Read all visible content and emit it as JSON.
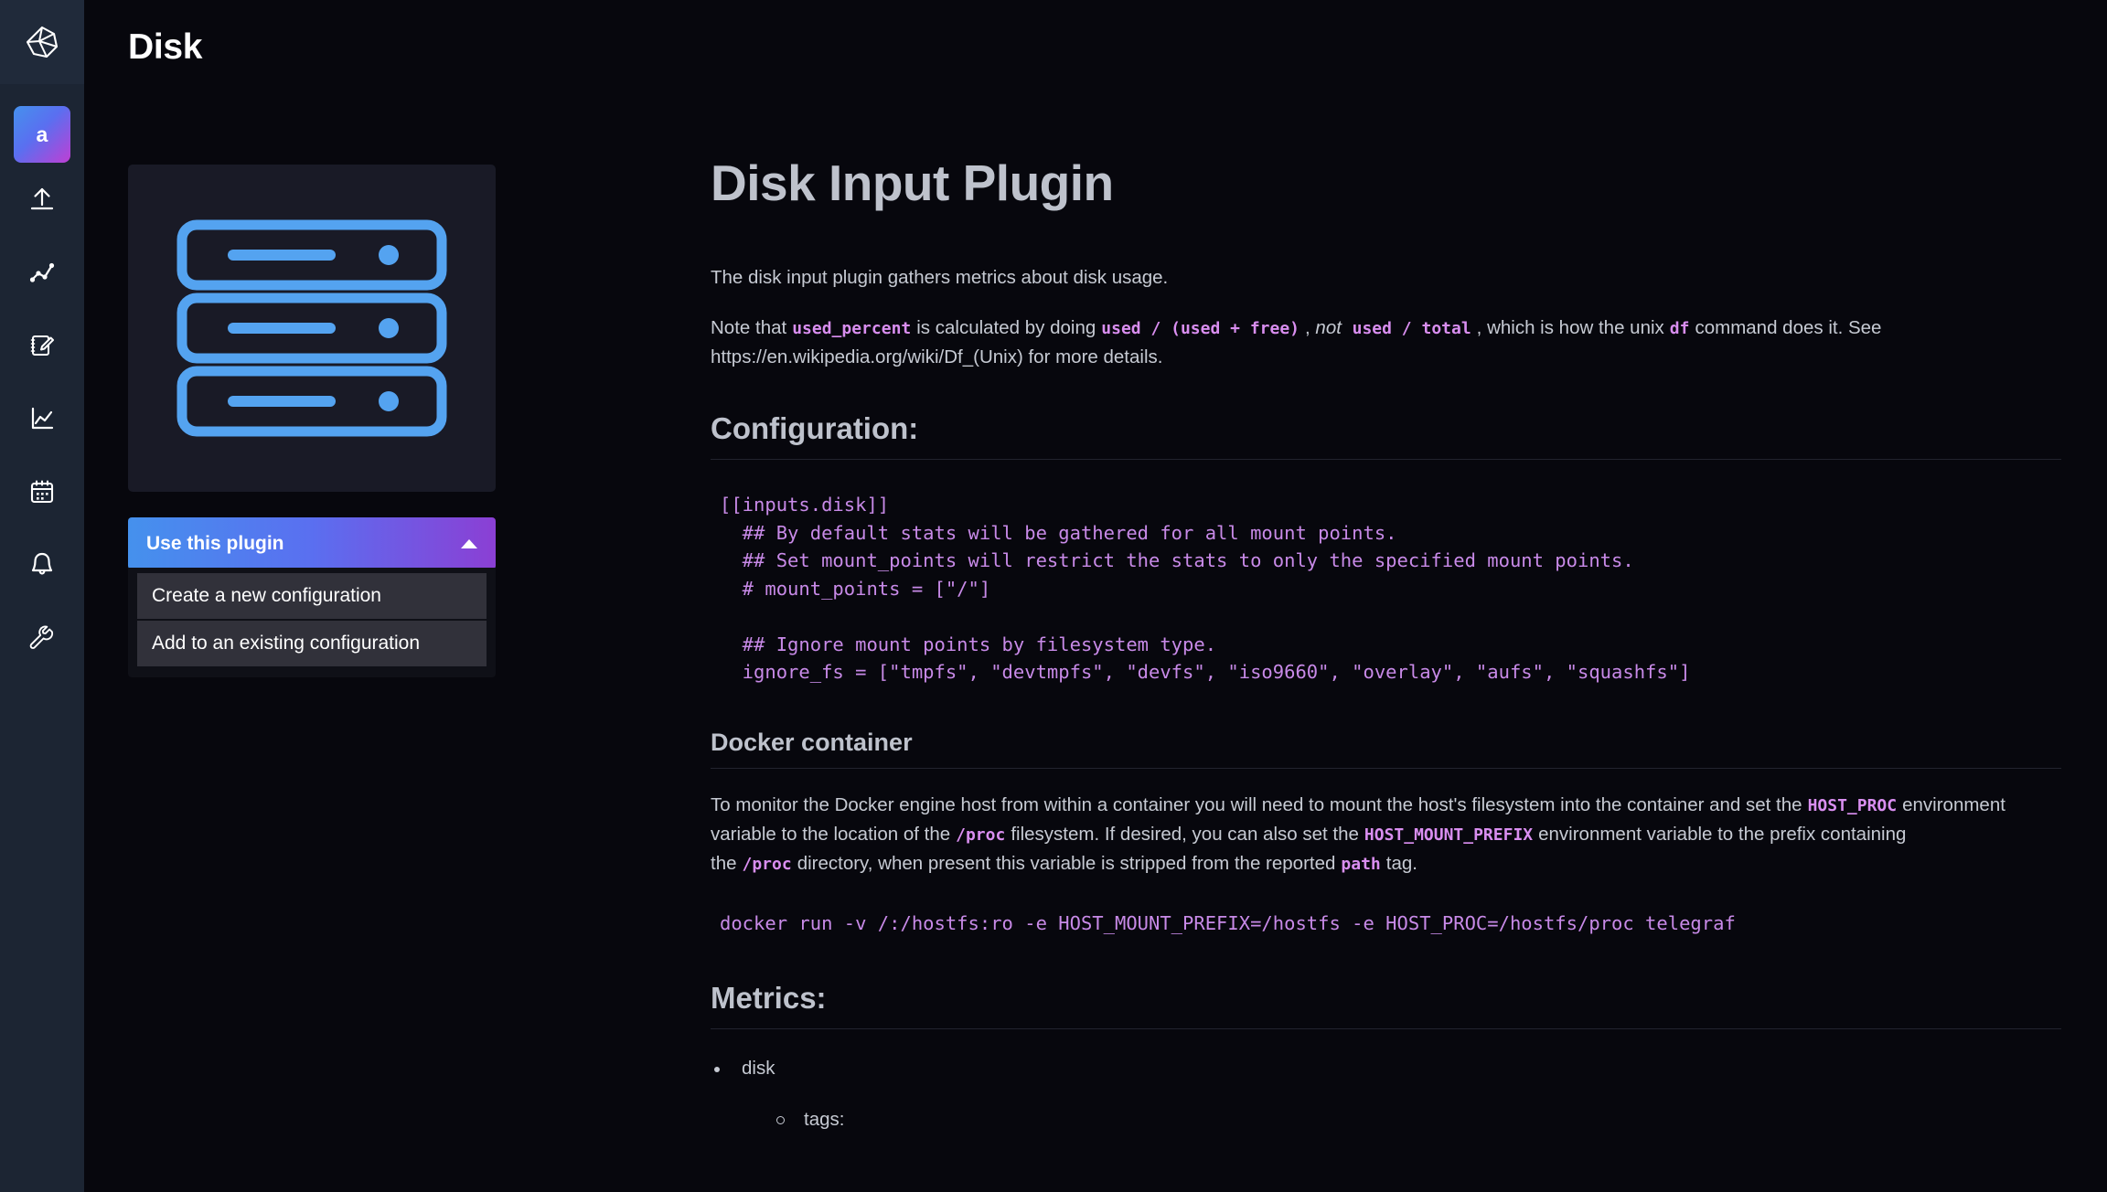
{
  "nav": {
    "logo_name": "influxdb-logo",
    "avatar_label": "a",
    "items": [
      {
        "name": "load-data",
        "icon": "upload-icon"
      },
      {
        "name": "data-explorer",
        "icon": "data-explorer-icon"
      },
      {
        "name": "notebooks",
        "icon": "notebook-edit-icon"
      },
      {
        "name": "dashboards",
        "icon": "dashboard-graph-icon"
      },
      {
        "name": "tasks",
        "icon": "calendar-icon"
      },
      {
        "name": "alerts",
        "icon": "bell-icon"
      },
      {
        "name": "settings",
        "icon": "wrench-icon"
      }
    ]
  },
  "header": {
    "title": "Disk"
  },
  "left_panel": {
    "card_icon": "disk-stack-icon",
    "use_plugin_label": "Use this plugin",
    "chevron_icon": "chevron-up-icon",
    "menu_items": [
      "Create a new configuration",
      "Add to an existing configuration"
    ]
  },
  "doc": {
    "title": "Disk Input Plugin",
    "intro": "The disk input plugin gathers metrics about disk usage.",
    "note": {
      "p1": "Note that",
      "c1": "used_percent",
      "p2": "is calculated by doing",
      "c2": "used / (used + free)",
      "p3": ",",
      "em": "not",
      "c3": "used / total",
      "p4": ", which is how the unix",
      "c4": "df",
      "p5": "command does it. See https://en.wikipedia.org/wiki/Df_(Unix) for more details."
    },
    "configuration_heading": "Configuration:",
    "configuration_code": "[[inputs.disk]]\n  ## By default stats will be gathered for all mount points.\n  ## Set mount_points will restrict the stats to only the specified mount points.\n  # mount_points = [\"/\"]\n\n  ## Ignore mount points by filesystem type.\n  ignore_fs = [\"tmpfs\", \"devtmpfs\", \"devfs\", \"iso9660\", \"overlay\", \"aufs\", \"squashfs\"]",
    "docker_heading": "Docker container",
    "docker": {
      "p1": "To monitor the Docker engine host from within a container you will need to mount the host's filesystem into the container and set the",
      "c1": "HOST_PROC",
      "p2": "environment variable to the location of the",
      "c2": "/proc",
      "p3": "filesystem. If desired, you can also set the",
      "c3": "HOST_MOUNT_PREFIX",
      "p4": "environment variable to the prefix containing the",
      "c4": "/proc",
      "p5": "directory, when present this variable is stripped from the reported",
      "c5": "path",
      "p6": "tag."
    },
    "docker_code": "docker run -v /:/hostfs:ro -e HOST_MOUNT_PREFIX=/hostfs -e HOST_PROC=/hostfs/proc telegraf",
    "metrics_heading": "Metrics:",
    "metrics_items": [
      {
        "label": "disk",
        "children": [
          "tags:"
        ]
      }
    ]
  },
  "colors": {
    "page_bg": "#07070d",
    "nav_bg": "#1c2533",
    "card_bg": "#191a26",
    "accent_blue": "#4591ed",
    "accent_purple": "#8b3fd4",
    "code_purple": "#c88ae8",
    "inline_code": "#d98ef0",
    "heading": "#bec2cc",
    "body_text": "#c6cad3",
    "disk_icon_blue": "#54a3f0"
  }
}
